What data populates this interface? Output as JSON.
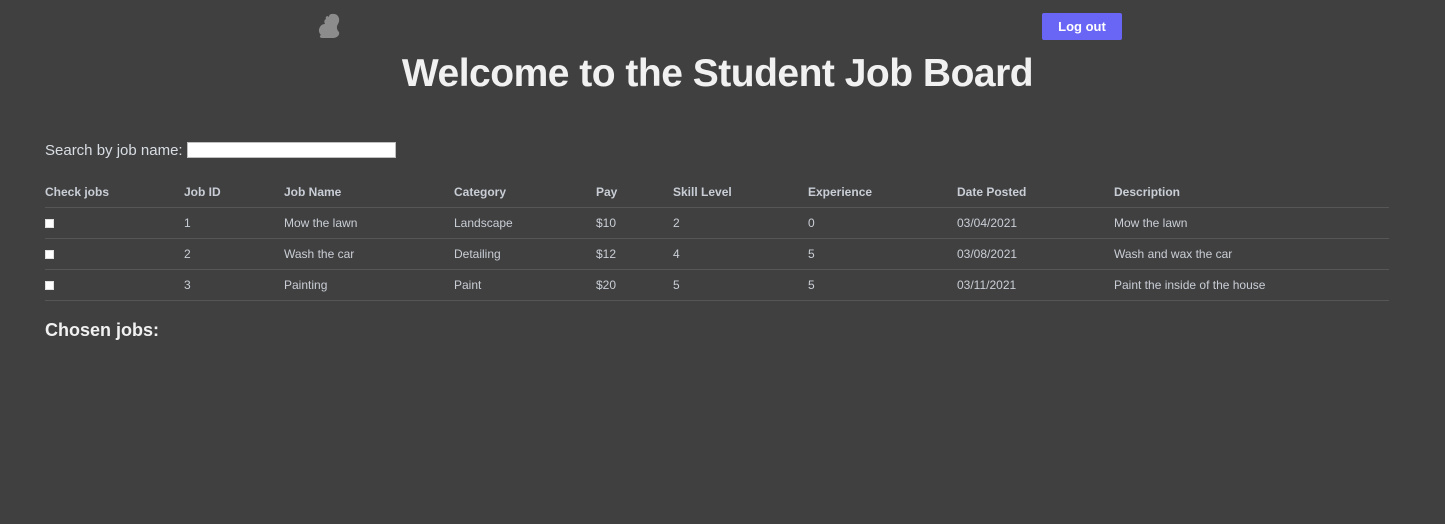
{
  "header": {
    "logo_icon": "squirrel-icon",
    "logout_label": "Log out",
    "title": "Welcome to the Student Job Board"
  },
  "search": {
    "label": "Search by job name:",
    "value": "",
    "placeholder": ""
  },
  "table": {
    "columns": [
      "Check jobs",
      "Job ID",
      "Job Name",
      "Category",
      "Pay",
      "Skill Level",
      "Experience",
      "Date Posted",
      "Description"
    ],
    "rows": [
      {
        "checked": false,
        "id": "1",
        "name": "Mow the lawn",
        "category": "Landscape",
        "pay": "$10",
        "skill": "2",
        "experience": "0",
        "date": "03/04/2021",
        "description": "Mow the lawn"
      },
      {
        "checked": false,
        "id": "2",
        "name": "Wash the car",
        "category": "Detailing",
        "pay": "$12",
        "skill": "4",
        "experience": "5",
        "date": "03/08/2021",
        "description": "Wash and wax the car"
      },
      {
        "checked": false,
        "id": "3",
        "name": "Painting",
        "category": "Paint",
        "pay": "$20",
        "skill": "5",
        "experience": "5",
        "date": "03/11/2021",
        "description": "Paint the inside of the house"
      }
    ]
  },
  "chosen": {
    "heading": "Chosen jobs:"
  },
  "colors": {
    "background": "#404040",
    "accent": "#6a66f5",
    "text": "#d8dde3"
  }
}
